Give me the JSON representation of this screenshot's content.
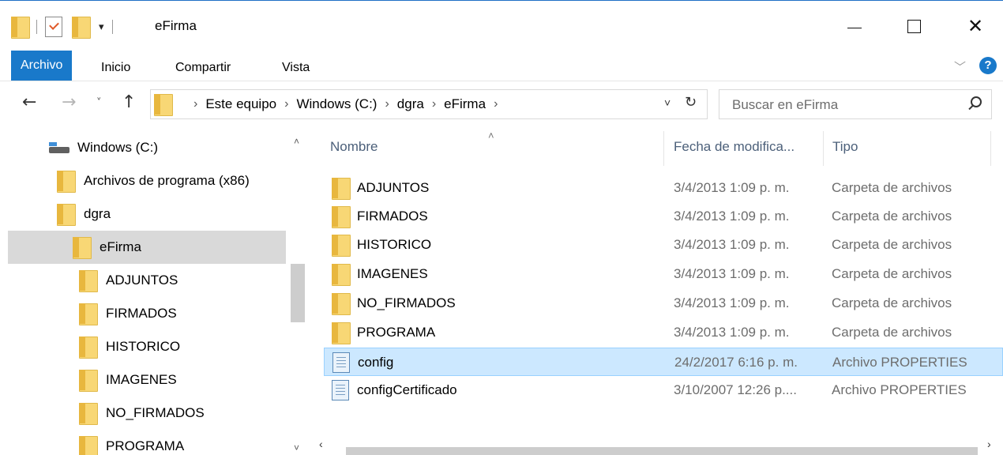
{
  "window": {
    "title": "eFirma",
    "qat_dropdown": "▾",
    "minimize": "",
    "maximize": "",
    "close": "✕"
  },
  "ribbon": {
    "tabs": [
      {
        "label": "Archivo",
        "active": true
      },
      {
        "label": "Inicio"
      },
      {
        "label": "Compartir"
      },
      {
        "label": "Vista"
      }
    ],
    "expand_chevron": "﹀",
    "help": "?"
  },
  "nav": {
    "back": "←",
    "forward": "→",
    "recent": "˅",
    "up": "↑"
  },
  "address": {
    "crumbs": [
      "Este equipo",
      "Windows (C:)",
      "dgra",
      "eFirma"
    ],
    "separator": "›",
    "dropdown": "˅",
    "refresh": "↻"
  },
  "search": {
    "placeholder": "Buscar en eFirma",
    "icon": "search-icon"
  },
  "tree": {
    "items": [
      {
        "label": "Windows (C:)",
        "icon": "drive-icon"
      },
      {
        "label": "Archivos de programa (x86)",
        "icon": "folder-icon"
      },
      {
        "label": "dgra",
        "icon": "folder-icon"
      },
      {
        "label": "eFirma",
        "icon": "folder-icon",
        "selected": true
      },
      {
        "label": "ADJUNTOS",
        "icon": "folder-icon"
      },
      {
        "label": "FIRMADOS",
        "icon": "folder-icon"
      },
      {
        "label": "HISTORICO",
        "icon": "folder-icon"
      },
      {
        "label": "IMAGENES",
        "icon": "folder-icon"
      },
      {
        "label": "NO_FIRMADOS",
        "icon": "folder-icon"
      },
      {
        "label": "PROGRAMA",
        "icon": "folder-icon"
      }
    ],
    "scroll_up": "˄",
    "scroll_down": "˅"
  },
  "list": {
    "sort_indicator": "˄",
    "columns": {
      "name": "Nombre",
      "date": "Fecha de modifica...",
      "type": "Tipo"
    },
    "rows": [
      {
        "name": "ADJUNTOS",
        "date": "3/4/2013 1:09 p. m.",
        "type": "Carpeta de archivos",
        "icon": "folder-icon"
      },
      {
        "name": "FIRMADOS",
        "date": "3/4/2013 1:09 p. m.",
        "type": "Carpeta de archivos",
        "icon": "folder-icon"
      },
      {
        "name": "HISTORICO",
        "date": "3/4/2013 1:09 p. m.",
        "type": "Carpeta de archivos",
        "icon": "folder-icon"
      },
      {
        "name": "IMAGENES",
        "date": "3/4/2013 1:09 p. m.",
        "type": "Carpeta de archivos",
        "icon": "folder-icon"
      },
      {
        "name": "NO_FIRMADOS",
        "date": "3/4/2013 1:09 p. m.",
        "type": "Carpeta de archivos",
        "icon": "folder-icon"
      },
      {
        "name": "PROGRAMA",
        "date": "3/4/2013 1:09 p. m.",
        "type": "Carpeta de archivos",
        "icon": "folder-icon"
      },
      {
        "name": "config",
        "date": "24/2/2017 6:16 p. m.",
        "type": "Archivo PROPERTIES",
        "icon": "properties-file-icon",
        "selected": true
      },
      {
        "name": "configCertificado",
        "date": "3/10/2007 12:26 p....",
        "type": "Archivo PROPERTIES",
        "icon": "properties-file-icon"
      }
    ],
    "scroll_left": "‹",
    "scroll_right": "›"
  },
  "colors": {
    "accent": "#1979ca",
    "selected_row": "#cce8ff",
    "selected_tree": "#d9d9d9",
    "folder": "#f8d775"
  }
}
